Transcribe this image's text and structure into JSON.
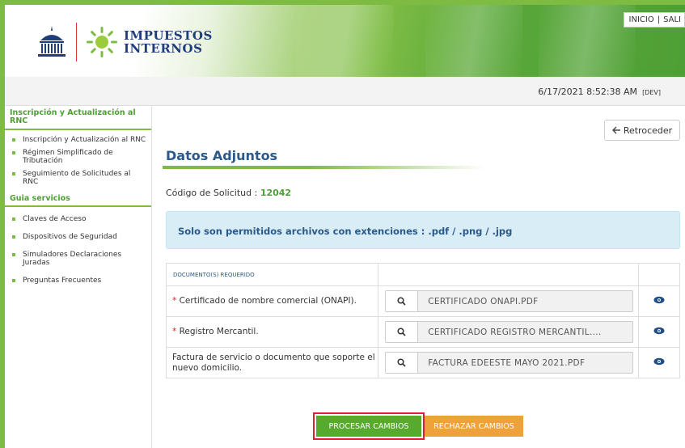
{
  "header": {
    "logo_line1": "IMPUESTOS",
    "logo_line2": "INTERNOS",
    "links": [
      "INICIO",
      "|",
      "SALI"
    ]
  },
  "datebar": {
    "datetime": "6/17/2021 8:52:38 AM",
    "env": "[DEV]"
  },
  "sidebar": {
    "section1_title": "Inscripción y Actualización al RNC",
    "section1_items": [
      "Inscripción y Actualización al RNC",
      "Régimen Simplificado de Tributación",
      "Seguimiento de Solicitudes al RNC"
    ],
    "section2_title": "Guia servicios",
    "section2_items": [
      "Claves de Acceso",
      "Dispositivos de Seguridad",
      "Simuladores Declaraciones Juradas",
      "Preguntas Frecuentes"
    ]
  },
  "main": {
    "back_label": "Retroceder",
    "title": "Datos Adjuntos",
    "codigo_label": "Código de Solicitud :",
    "codigo_value": "12042",
    "alert": "Solo son permitidos archivos con extenciones : .pdf / .png / .jpg",
    "table_header": "DOCUMENTO(S) REQUERIDO",
    "documents": [
      {
        "required": "*",
        "name": "Certificado de nombre comercial (ONAPI).",
        "file": "CERTIFICADO ONAPI.PDF"
      },
      {
        "required": "*",
        "name": "Registro Mercantil.",
        "file": "CERTIFICADO REGISTRO MERCANTIL...."
      },
      {
        "required": "",
        "name": "Factura de servicio o documento que soporte el nuevo domicilio.",
        "file": "FACTURA EDEESTE MAYO 2021.PDF"
      }
    ],
    "btn_procesar": "PROCESAR CAMBIOS",
    "btn_rechazar": "RECHAZAR CAMBIOS"
  },
  "colors": {
    "brand_green": "#7dbb42",
    "title_blue": "#2b5a8a",
    "process_button": "#56ab2f",
    "reject_button": "#f0a23a",
    "highlight_border": "#e0202e"
  },
  "icons": {
    "search": "search-icon",
    "view": "eye-icon",
    "back": "back-arrow-icon"
  }
}
